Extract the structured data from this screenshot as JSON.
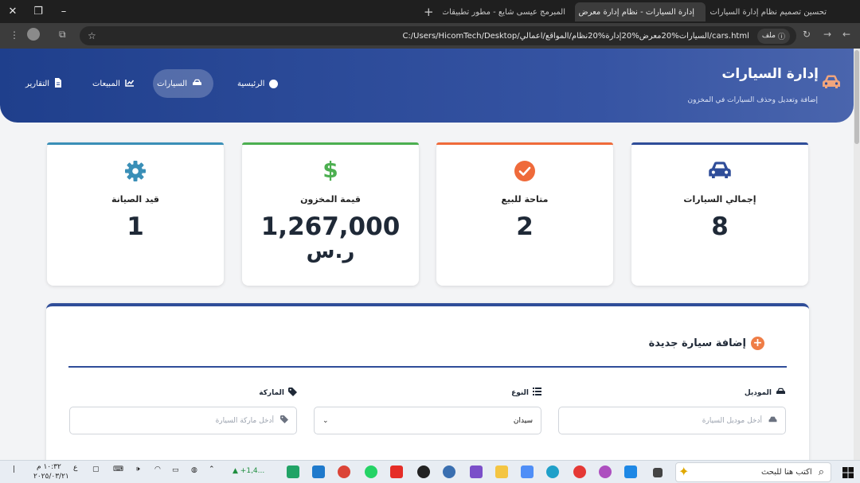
{
  "browser": {
    "tabs": [
      {
        "title": "تحسين تصميم نظام إدارة السيارات",
        "active": false
      },
      {
        "title": "إدارة السيارات - نظام إدارة معرض",
        "active": true
      },
      {
        "title": "المبرمج عيسى شايع - مطور تطبيقات",
        "active": false
      }
    ],
    "address_prefix": "ملف",
    "url": "C:/Users/HicomTech/Desktop/السيارات%20معرض%20إدارة%20نظام/المواقع/اعمالي/cars.html"
  },
  "header": {
    "title": "إدارة السيارات",
    "subtitle": "إضافة وتعديل وحذف السيارات في المخزون",
    "nav": [
      {
        "label": "الرئيسية",
        "icon": "gauge-icon"
      },
      {
        "label": "السيارات",
        "icon": "car-icon",
        "active": true
      },
      {
        "label": "المبيعات",
        "icon": "chart-line-icon"
      },
      {
        "label": "التقارير",
        "icon": "file-icon"
      }
    ]
  },
  "stats": [
    {
      "label": "إجمالي السيارات",
      "value": "8",
      "icon": "car-icon",
      "color": "#2f4d99"
    },
    {
      "label": "متاحة للبيع",
      "value": "2",
      "icon": "check-circle-icon",
      "color": "#ef6a3a"
    },
    {
      "label": "قيمة المخزون",
      "value": "1,267,000",
      "unit": "ر.س",
      "icon": "dollar-icon",
      "color": "#4caf50"
    },
    {
      "label": "قيد الصيانة",
      "value": "1",
      "icon": "gear-icon",
      "color": "#3a8fb7"
    }
  ],
  "form": {
    "title": "إضافة سيارة جديدة",
    "model_label": "الموديل",
    "model_placeholder": "أدخل موديل السيارة",
    "type_label": "النوع",
    "type_value": "سيدان",
    "brand_label": "الماركة",
    "brand_placeholder": "أدخل ماركة السيارة"
  },
  "taskbar": {
    "search_placeholder": "اكتب هنا للبحث",
    "stock": "+1,4...",
    "time": "١٠:٣٢ م",
    "date": "٢٠٢٥/٠٣/٢١",
    "lang": "ع"
  },
  "colors": {
    "header": "#2f4d99",
    "accent": "#ef7d46"
  }
}
